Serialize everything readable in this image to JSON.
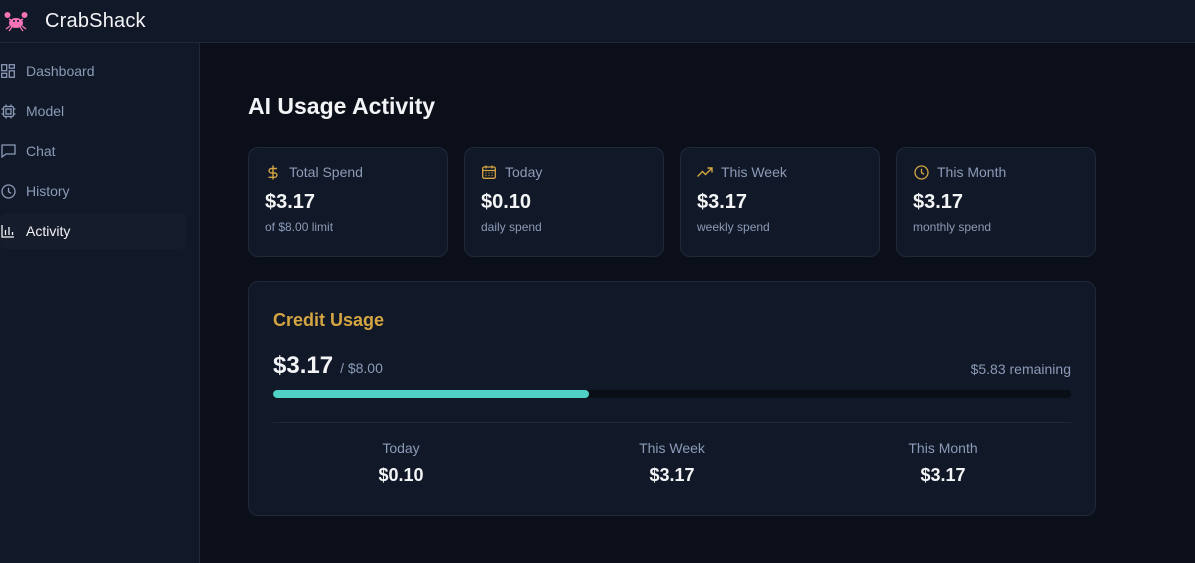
{
  "app": {
    "title": "CrabShack",
    "logo_icon": "crab-icon"
  },
  "sidebar": {
    "items": [
      {
        "label": "Dashboard",
        "icon": "dashboard-icon",
        "active": false
      },
      {
        "label": "Model",
        "icon": "chip-icon",
        "active": false
      },
      {
        "label": "Chat",
        "icon": "chat-icon",
        "active": false
      },
      {
        "label": "History",
        "icon": "clock-icon",
        "active": false
      },
      {
        "label": "Activity",
        "icon": "bar-chart-icon",
        "active": true
      }
    ]
  },
  "page": {
    "title": "AI Usage Activity"
  },
  "stats": [
    {
      "label": "Total Spend",
      "icon": "dollar-icon",
      "value": "$3.17",
      "sub": "of $8.00 limit"
    },
    {
      "label": "Today",
      "icon": "calendar-icon",
      "value": "$0.10",
      "sub": "daily spend"
    },
    {
      "label": "This Week",
      "icon": "trending-up-icon",
      "value": "$3.17",
      "sub": "weekly spend"
    },
    {
      "label": "This Month",
      "icon": "clock-icon",
      "value": "$3.17",
      "sub": "monthly spend"
    }
  ],
  "credit": {
    "title": "Credit Usage",
    "used": "$3.17",
    "limit": "/ $8.00",
    "remaining": "$5.83 remaining",
    "progress_fraction": 0.396,
    "breakdown": [
      {
        "label": "Today",
        "value": "$0.10"
      },
      {
        "label": "This Week",
        "value": "$3.17"
      },
      {
        "label": "This Month",
        "value": "$3.17"
      }
    ]
  },
  "colors": {
    "accent_gold": "#d4a542",
    "progress": "#4fd1c5",
    "logo": "#f472b6",
    "background": "#0b0f19",
    "panel": "#111827"
  }
}
